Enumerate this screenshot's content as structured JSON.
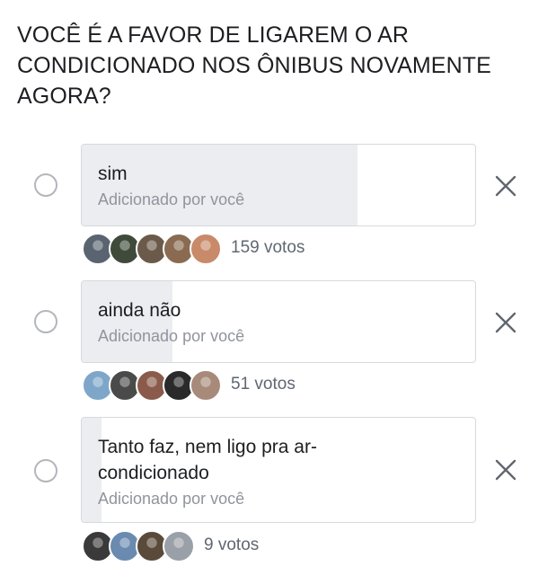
{
  "poll": {
    "question": "VOCÊ É A FAVOR DE LIGAREM O AR CONDICIONADO NOS ÔNIBUS NOVAMENTE AGORA?",
    "options": [
      {
        "label": "sim",
        "added_by": "Adicionado por você",
        "votes_label": "159 votos",
        "votes": 159,
        "vote_share": 0.7,
        "voter_avatars": [
          "#5a6470",
          "#3f4a3a",
          "#6b5a4a",
          "#8a6b52",
          "#c98a6a"
        ]
      },
      {
        "label": "ainda não",
        "added_by": "Adicionado por você",
        "votes_label": "51 votos",
        "votes": 51,
        "vote_share": 0.23,
        "voter_avatars": [
          "#7ea6c8",
          "#4a4a4a",
          "#8a5a4a",
          "#2a2a2a",
          "#a88a7a"
        ]
      },
      {
        "label": "Tanto faz, nem ligo pra ar-condicionado",
        "added_by": "Adicionado por você",
        "votes_label": "9 votos",
        "votes": 9,
        "vote_share": 0.05,
        "voter_avatars": [
          "#3a3a3a",
          "#6a8ab0",
          "#5a4a3a",
          "#9aa0a8"
        ]
      }
    ]
  },
  "icons": {
    "remove": "close-icon",
    "select": "radio-icon"
  },
  "colors": {
    "bar_fill": "#ebedf0",
    "border": "#d6d9dd",
    "muted_text": "#90949c",
    "votes_text": "#606770"
  }
}
